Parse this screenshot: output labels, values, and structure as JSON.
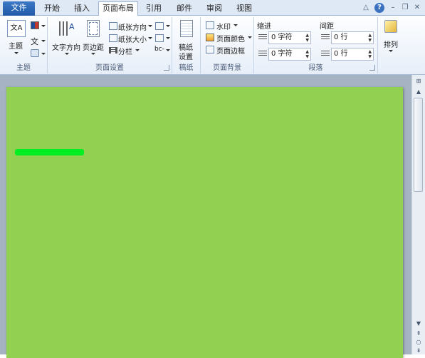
{
  "tabs": {
    "file": "文件",
    "items": [
      "开始",
      "插入",
      "页面布局",
      "引用",
      "邮件",
      "审阅",
      "视图"
    ],
    "active": "页面布局"
  },
  "window_controls": [
    "△",
    "?",
    "–",
    "❐",
    "✕"
  ],
  "ribbon": {
    "theme_group": {
      "label": "主题",
      "theme_button": "主题",
      "theme_glyph": "文A",
      "fonts_glyph": "文"
    },
    "page_setup_group": {
      "label": "页面设置",
      "text_direction": "文字方向",
      "margins": "页边距",
      "orientation": "纸张方向",
      "size": "纸张大小",
      "columns": "分栏",
      "hyphenation_glyph": "bc-"
    },
    "draft_group": {
      "label": "稿纸",
      "button": "稿纸\n设置",
      "line1": "稿纸",
      "line2": "设置"
    },
    "page_background_group": {
      "label": "页面背景",
      "watermark": "水印",
      "page_color": "页面颜色",
      "page_borders": "页面边框"
    },
    "paragraph_group": {
      "label": "段落",
      "indent_label": "缩进",
      "spacing_label": "间距",
      "indent_left": "0 字符",
      "indent_right": "0 字符",
      "spacing_before": "0 行",
      "spacing_after": "0 行"
    },
    "arrange_group": {
      "label": "排列"
    }
  },
  "document": {
    "page_color": "#91d050",
    "mark_color": "#00ee22"
  }
}
